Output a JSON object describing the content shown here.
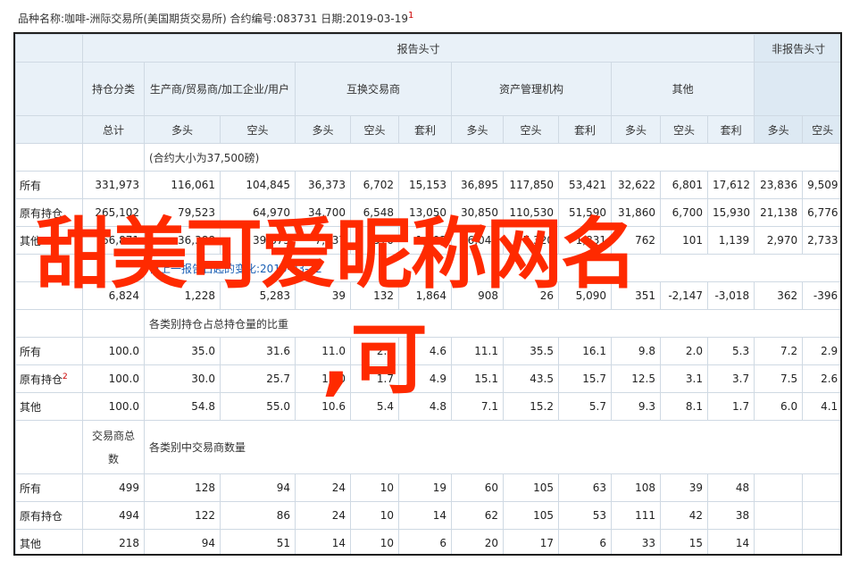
{
  "header": {
    "text": "品种名称:咖啡-洲际交易所(美国期货交易所)    合约编号:083731    日期:2019-03-19",
    "mark": "1"
  },
  "columns": {
    "report_group": "报告头寸",
    "nonreport_group": "非报告头寸",
    "holding_class": "持仓分类",
    "producers": "生产商/贸易商/加工企业/用户",
    "swap": "互换交易商",
    "asset_mgr": "资产管理机构",
    "other": "其他",
    "total": "总计",
    "long": "多头",
    "short": "空头",
    "spread": "套利"
  },
  "sections": {
    "contract_size": "(合约大小为37,500磅)",
    "change": "自上一报告日起的变化:2019-03-12",
    "pct": "各类别持仓占总持仓量的比重",
    "traders_label": "交易商总数",
    "traders": "各类别中交易商数量"
  },
  "rows": {
    "positions": [
      {
        "label": "所有",
        "v": [
          "331,973",
          "116,061",
          "104,845",
          "36,373",
          "6,702",
          "15,153",
          "36,895",
          "117,850",
          "53,421",
          "32,622",
          "6,801",
          "17,612",
          "23,836",
          "9,509"
        ]
      },
      {
        "label": "原有持仓",
        "v": [
          "265,102",
          "79,523",
          "64,970",
          "34,700",
          "6,548",
          "13,050",
          "30,850",
          "110,530",
          "51,590",
          "31,860",
          "6,700",
          "15,930",
          "21,138",
          "6,776"
        ]
      },
      {
        "label": "其他",
        "v": [
          "66,871",
          "36,388",
          "39,875",
          "7,037",
          "570",
          "1,103",
          "6,045",
          "7,320",
          "1,831",
          "762",
          "101",
          "1,139",
          "2,970",
          "2,733"
        ]
      }
    ],
    "change": [
      "6,824",
      "1,228",
      "5,283",
      "39",
      "132",
      "1,864",
      "908",
      "26",
      "5,090",
      "351",
      "-2,147",
      "-3,018",
      "362",
      "-396"
    ],
    "pct": [
      {
        "label": "所有",
        "v": [
          "100.0",
          "35.0",
          "31.6",
          "11.0",
          "2.0",
          "4.6",
          "11.1",
          "35.5",
          "16.1",
          "9.8",
          "2.0",
          "5.3",
          "7.2",
          "2.9"
        ]
      },
      {
        "label": "原有持仓",
        "mark": "2",
        "v": [
          "100.0",
          "30.0",
          "25.7",
          "11.0",
          "1.7",
          "4.9",
          "15.1",
          "43.5",
          "15.7",
          "12.5",
          "3.1",
          "3.7",
          "7.5",
          "2.6"
        ]
      },
      {
        "label": "其他",
        "v": [
          "100.0",
          "54.8",
          "55.0",
          "10.6",
          "5.4",
          "4.8",
          "7.1",
          "15.2",
          "5.7",
          "9.3",
          "8.1",
          "1.7",
          "6.0",
          "4.1"
        ]
      }
    ],
    "traders": [
      {
        "label": "所有",
        "v": [
          "499",
          "128",
          "94",
          "24",
          "10",
          "19",
          "60",
          "105",
          "63",
          "108",
          "39",
          "48",
          "",
          ""
        ]
      },
      {
        "label": "原有持仓",
        "v": [
          "494",
          "122",
          "86",
          "24",
          "10",
          "14",
          "62",
          "105",
          "53",
          "111",
          "42",
          "38",
          "",
          ""
        ]
      },
      {
        "label": "其他",
        "v": [
          "218",
          "94",
          "51",
          "14",
          "10",
          "6",
          "20",
          "17",
          "6",
          "33",
          "15",
          "14",
          "",
          ""
        ]
      }
    ]
  },
  "watermark": {
    "line1": "甜美可爱昵称网名",
    "line2": ",可"
  }
}
